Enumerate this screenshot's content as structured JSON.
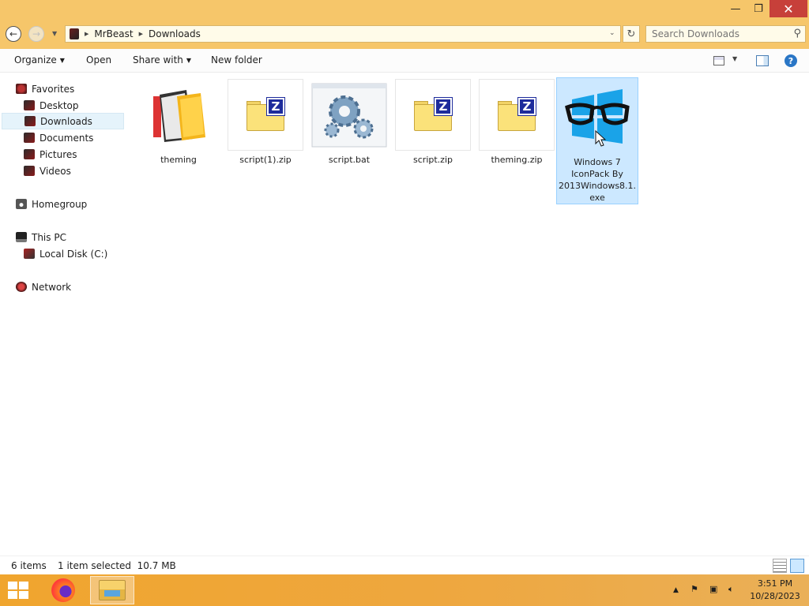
{
  "window": {
    "controls": {
      "minimize": "—",
      "maximize": "❐",
      "close": "✕"
    }
  },
  "address": {
    "crumbs": [
      "MrBeast",
      "Downloads"
    ],
    "search_placeholder": "Search Downloads"
  },
  "commands": {
    "organize": "Organize",
    "open": "Open",
    "share_with": "Share with",
    "new_folder": "New folder",
    "help": "?"
  },
  "nav": {
    "favorites": "Favorites",
    "desktop": "Desktop",
    "downloads": "Downloads",
    "documents": "Documents",
    "pictures": "Pictures",
    "videos": "Videos",
    "homegroup": "Homegroup",
    "this_pc": "This PC",
    "local_disk": "Local Disk (C:)",
    "network": "Network"
  },
  "files": [
    {
      "name": "theming",
      "icon": "theming-folder-icon"
    },
    {
      "name": "script(1).zip",
      "icon": "zip-icon"
    },
    {
      "name": "script.bat",
      "icon": "bat-gears-icon"
    },
    {
      "name": "script.zip",
      "icon": "zip-icon"
    },
    {
      "name": "theming.zip",
      "icon": "zip-icon"
    },
    {
      "name": "Windows 7 IconPack By 2013Windows8.1.exe",
      "icon": "glasses-windows-icon",
      "selected": true
    }
  ],
  "status": {
    "item_count": "6 items",
    "selection": "1 item selected  10.7 MB"
  },
  "taskbar": {
    "time": "3:51 PM",
    "date": "10/28/2023"
  },
  "colors": {
    "accent": "#f6c66a",
    "taskbar": "#f0a52e",
    "selection": "#cce8ff"
  }
}
